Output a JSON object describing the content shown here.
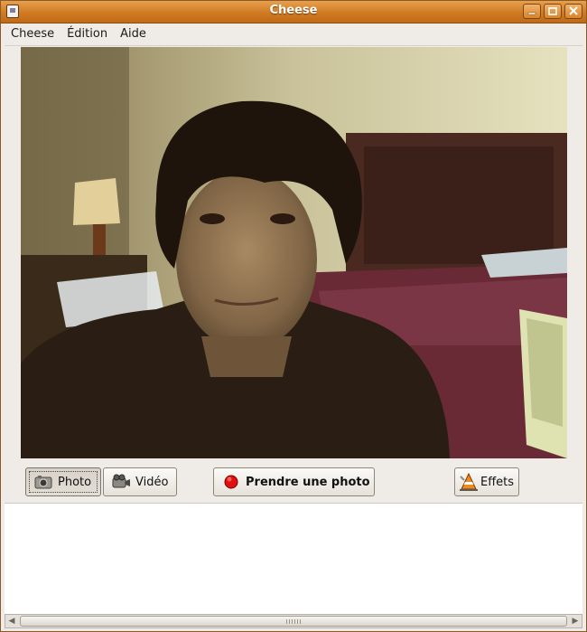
{
  "window": {
    "title": "Cheese"
  },
  "menubar": {
    "items": [
      "Cheese",
      "Édition",
      "Aide"
    ]
  },
  "toolbar": {
    "photo_label": "Photo",
    "video_label": "Vidéo",
    "shoot_label": "Prendre une photo",
    "effects_label": "Effets"
  },
  "colors": {
    "titlebar": "#d07a22",
    "record_dot": "#e01010",
    "window_bg": "#efebe7"
  },
  "icons": [
    "camera-icon",
    "video-camera-icon",
    "record-dot-icon",
    "effects-cone-icon",
    "minimize-icon",
    "maximize-icon",
    "close-icon"
  ]
}
